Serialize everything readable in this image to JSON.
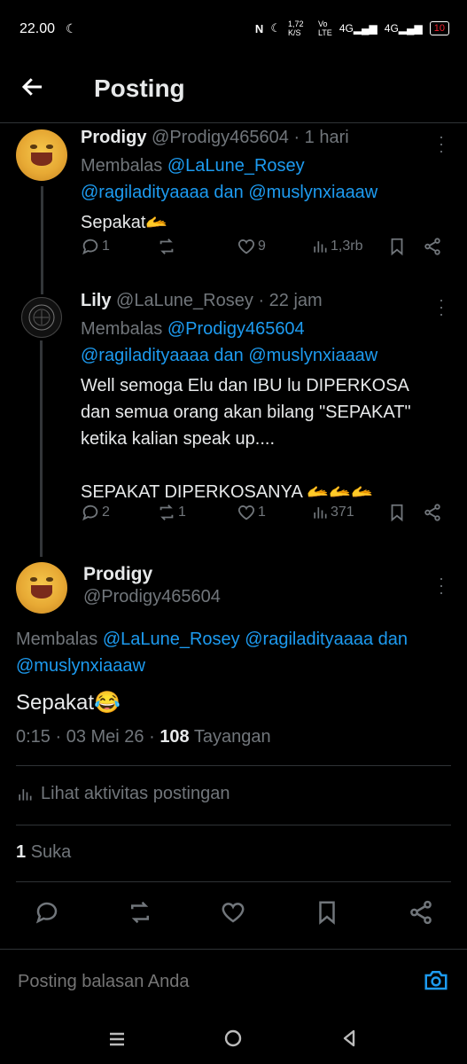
{
  "status": {
    "time": "22.00",
    "speed": "1,72 K/S",
    "battery": "10"
  },
  "header": {
    "title": "Posting"
  },
  "reply1": {
    "name": "Prodigy",
    "handle": "@Prodigy465604",
    "time": "· 1 hari",
    "replying": "Membalas",
    "mention1": "@LaLune_Rosey",
    "mention2": "@ragiladityaaaa",
    "and": "dan",
    "mention3": "@muslynxiaaaw",
    "text": "Sepakat🫴",
    "replies": "1",
    "retweets": "",
    "likes": "9",
    "views": "1,3rb"
  },
  "reply2": {
    "name": "Lily",
    "handle": "@LaLune_Rosey",
    "time": "· 22 jam",
    "replying": "Membalas",
    "mention1": "@Prodigy465604",
    "mention2": "@ragiladityaaaa",
    "and": "dan",
    "mention3": "@muslynxiaaaw",
    "text1": "Well semoga Elu dan IBU lu DIPERKOSA",
    "text2": "dan semua orang akan bilang \"SEPAKAT\"",
    "text3": "ketika kalian speak up....",
    "text4": "SEPAKAT DIPERKOSANYA 🫴🫴🫴",
    "replies": "2",
    "retweets": "1",
    "likes": "1",
    "views": "371"
  },
  "main": {
    "name": "Prodigy",
    "handle": "@Prodigy465604",
    "replying": "Membalas",
    "mention1": "@LaLune_Rosey",
    "mention2": "@ragiladityaaaa",
    "and": "dan",
    "mention3": "@muslynxiaaaw",
    "text": "Sepakat😂",
    "time": "0:15 · 03 Mei 26 ·",
    "views_count": "108",
    "views_label": "Tayangan",
    "activity": "Lihat aktivitas postingan",
    "likes_count": "1",
    "likes_label": "Suka"
  },
  "reply_input": {
    "placeholder": "Posting balasan Anda"
  },
  "colors": {
    "accent": "#1d9bf0",
    "muted": "#71767b",
    "bg": "#000000"
  }
}
